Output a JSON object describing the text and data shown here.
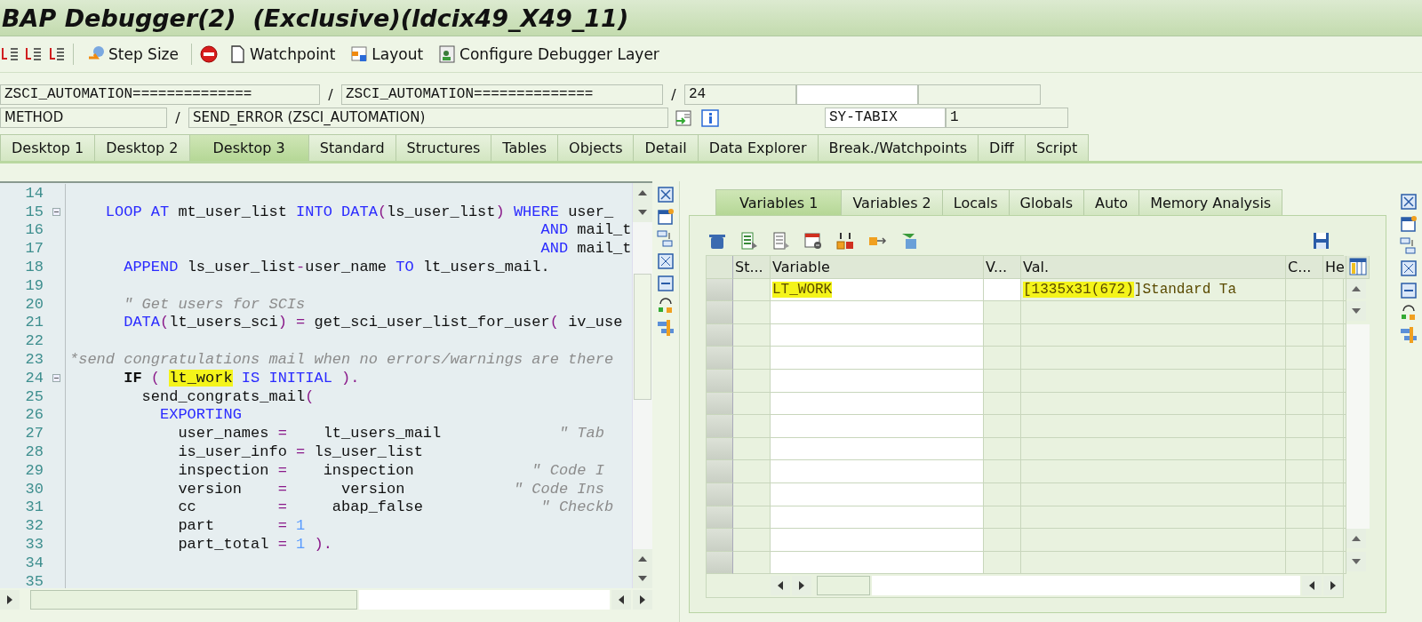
{
  "window": {
    "title": "BAP Debugger(2)  (Exclusive)(ldcix49_X49_11)"
  },
  "toolbar": {
    "buttons": [
      {
        "label": "Step Size"
      },
      {
        "label": "Watchpoint"
      },
      {
        "label": "Layout"
      },
      {
        "label": "Configure Debugger Layer"
      }
    ]
  },
  "fields": {
    "row1": [
      {
        "kind": "field",
        "value": "ZSCI_AUTOMATION=============="
      },
      {
        "kind": "sep",
        "value": "/"
      },
      {
        "kind": "field",
        "value": "ZSCI_AUTOMATION=============="
      },
      {
        "kind": "sep",
        "value": "/"
      },
      {
        "kind": "field",
        "value": "24"
      },
      {
        "kind": "input"
      },
      {
        "kind": "field"
      }
    ],
    "row2": [
      {
        "kind": "field",
        "value": "METHOD"
      },
      {
        "kind": "sep",
        "value": "/"
      },
      {
        "kind": "field",
        "value": "SEND_ERROR (ZSCI_AUTOMATION)"
      },
      {
        "kind": "icons"
      },
      {
        "kind": "input",
        "value": "SY-TABIX"
      },
      {
        "kind": "field",
        "value": "1"
      }
    ]
  },
  "tabs": [
    {
      "label": "Desktop 1",
      "selected": false
    },
    {
      "label": "Desktop 2",
      "selected": false
    },
    {
      "label": "Desktop 3",
      "selected": true
    },
    {
      "label": "Standard",
      "selected": false
    },
    {
      "label": "Structures",
      "selected": false
    },
    {
      "label": "Tables",
      "selected": false
    },
    {
      "label": "Objects",
      "selected": false
    },
    {
      "label": "Detail",
      "selected": false
    },
    {
      "label": "Data Explorer",
      "selected": false
    },
    {
      "label": "Break./Watchpoints",
      "selected": false
    },
    {
      "label": "Diff",
      "selected": false
    },
    {
      "label": "Script",
      "selected": false
    }
  ],
  "code": [
    {
      "no": "14",
      "fold": false
    },
    {
      "no": "15",
      "fold": true,
      "tokens": [
        {
          "kind": "kw",
          "text": "    LOOP AT "
        },
        {
          "kind": "id",
          "text": "mt_user_list "
        },
        {
          "kind": "kw",
          "text": "INTO DATA"
        },
        {
          "kind": "op",
          "text": "("
        },
        {
          "kind": "id",
          "text": "ls_user_list"
        },
        {
          "kind": "op",
          "text": ") "
        },
        {
          "kind": "kw",
          "text": "WHERE "
        },
        {
          "kind": "id",
          "text": "user_"
        }
      ]
    },
    {
      "no": "16",
      "fold": false,
      "tokens": [
        {
          "kind": "kw",
          "text": "                                                    AND "
        },
        {
          "kind": "id",
          "text": "mail_t"
        }
      ]
    },
    {
      "no": "17",
      "fold": false,
      "tokens": [
        {
          "kind": "kw",
          "text": "                                                    AND "
        },
        {
          "kind": "id",
          "text": "mail_t"
        }
      ]
    },
    {
      "no": "18",
      "fold": false,
      "tokens": [
        {
          "kind": "kw",
          "text": "      APPEND "
        },
        {
          "kind": "id",
          "text": "ls_user_list"
        },
        {
          "kind": "op",
          "text": "-"
        },
        {
          "kind": "id",
          "text": "user_name "
        },
        {
          "kind": "kw",
          "text": "TO "
        },
        {
          "kind": "id",
          "text": "lt_users_mail."
        }
      ]
    },
    {
      "no": "19",
      "fold": false
    },
    {
      "no": "20",
      "fold": false,
      "tokens": [
        {
          "kind": "cmt",
          "text": "      \" Get users for SCIs"
        }
      ]
    },
    {
      "no": "21",
      "fold": false,
      "tokens": [
        {
          "kind": "kw",
          "text": "      DATA"
        },
        {
          "kind": "op",
          "text": "("
        },
        {
          "kind": "id",
          "text": "lt_users_sci"
        },
        {
          "kind": "op",
          "text": ") = "
        },
        {
          "kind": "id",
          "text": "get_sci_user_list_for_user"
        },
        {
          "kind": "op",
          "text": "( "
        },
        {
          "kind": "id",
          "text": "iv_use"
        }
      ]
    },
    {
      "no": "22",
      "fold": false
    },
    {
      "no": "23",
      "fold": false,
      "tokens": [
        {
          "kind": "cmt",
          "text": "*send congratulations mail when no errors/warnings are there"
        }
      ]
    },
    {
      "no": "24",
      "fold": true,
      "tokens": [
        {
          "kind": "bold",
          "text": "      IF "
        },
        {
          "kind": "op",
          "text": "( "
        },
        {
          "kind": "hl",
          "text": "lt_work"
        },
        {
          "kind": "kw",
          "text": " IS INITIAL "
        },
        {
          "kind": "op",
          "text": ")."
        }
      ]
    },
    {
      "no": "25",
      "fold": false,
      "tokens": [
        {
          "kind": "id",
          "text": "        send_congrats_mail"
        },
        {
          "kind": "op",
          "text": "("
        }
      ]
    },
    {
      "no": "26",
      "fold": false,
      "tokens": [
        {
          "kind": "kw",
          "text": "          EXPORTING"
        }
      ]
    },
    {
      "no": "27",
      "fold": false,
      "tokens": [
        {
          "kind": "id",
          "text": "            user_names "
        },
        {
          "kind": "op",
          "text": "=    "
        },
        {
          "kind": "id",
          "text": "lt_users_mail             "
        },
        {
          "kind": "cmt",
          "text": "\" Tab"
        }
      ]
    },
    {
      "no": "28",
      "fold": false,
      "tokens": [
        {
          "kind": "id",
          "text": "            is_user_info "
        },
        {
          "kind": "op",
          "text": "= "
        },
        {
          "kind": "id",
          "text": "ls_user_list"
        }
      ]
    },
    {
      "no": "29",
      "fold": false,
      "tokens": [
        {
          "kind": "id",
          "text": "            inspection "
        },
        {
          "kind": "op",
          "text": "=    "
        },
        {
          "kind": "id",
          "text": "inspection             "
        },
        {
          "kind": "cmt",
          "text": "\" Code I"
        }
      ]
    },
    {
      "no": "30",
      "fold": false,
      "tokens": [
        {
          "kind": "id",
          "text": "            version    "
        },
        {
          "kind": "op",
          "text": "=      "
        },
        {
          "kind": "id",
          "text": "version            "
        },
        {
          "kind": "cmt",
          "text": "\" Code Ins"
        }
      ]
    },
    {
      "no": "31",
      "fold": false,
      "tokens": [
        {
          "kind": "id",
          "text": "            cc         "
        },
        {
          "kind": "op",
          "text": "=     "
        },
        {
          "kind": "id",
          "text": "abap_false             "
        },
        {
          "kind": "cmt",
          "text": "\" Checkb"
        }
      ]
    },
    {
      "no": "32",
      "fold": false,
      "tokens": [
        {
          "kind": "id",
          "text": "            part       "
        },
        {
          "kind": "op",
          "text": "= "
        },
        {
          "kind": "num",
          "text": "1"
        }
      ]
    },
    {
      "no": "33",
      "fold": false,
      "tokens": [
        {
          "kind": "id",
          "text": "            part_total "
        },
        {
          "kind": "op",
          "text": "= "
        },
        {
          "kind": "num",
          "text": "1"
        },
        {
          "kind": "op",
          "text": " )."
        }
      ]
    },
    {
      "no": "34",
      "fold": false
    },
    {
      "no": "35",
      "fold": false
    }
  ],
  "var_tabs": [
    {
      "label": "Variables 1",
      "selected": true
    },
    {
      "label": "Variables 2",
      "selected": false
    },
    {
      "label": "Locals",
      "selected": false
    },
    {
      "label": "Globals",
      "selected": false
    },
    {
      "label": "Auto",
      "selected": false
    },
    {
      "label": "Memory Analysis",
      "selected": false
    }
  ],
  "var_table": {
    "columns": [
      "St...",
      "Variable",
      "V...",
      "Val.",
      "C...",
      "He"
    ],
    "rows": [
      {
        "variable": "LT_WORK",
        "highlight": true,
        "value_parts": [
          {
            "text": "[1335x31(672)",
            "highlight": true
          },
          {
            "text": "]Standard Ta",
            "highlight": false
          }
        ]
      }
    ]
  }
}
